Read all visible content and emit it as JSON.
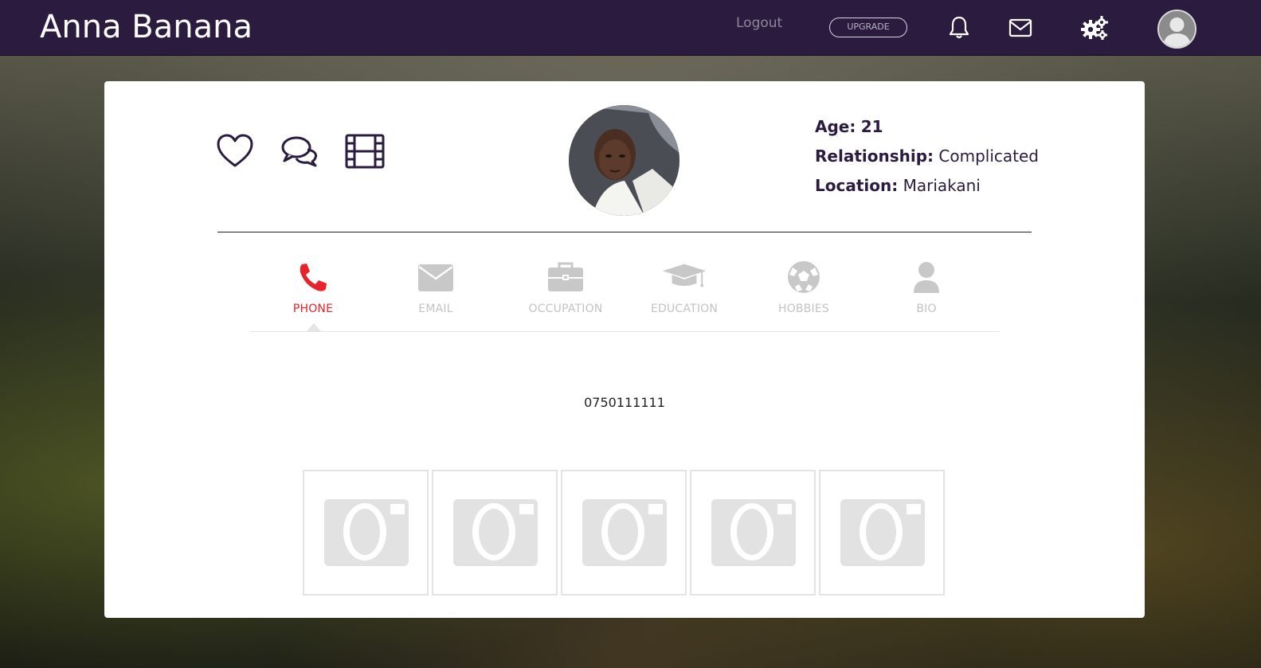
{
  "header": {
    "brand": "Anna Banana",
    "logout_label": "Logout",
    "upgrade_label": "UPGRADE",
    "icons": [
      "bell-icon",
      "envelope-icon",
      "gears-icon",
      "user-avatar"
    ]
  },
  "profile": {
    "actions": [
      "heart-icon",
      "chat-bubbles-icon",
      "film-icon"
    ],
    "age_label": "Age:",
    "age_value": "21",
    "relationship_label": "Relationship:",
    "relationship_value": "Complicated",
    "location_label": "Location:",
    "location_value": "Mariakani"
  },
  "tabs": [
    {
      "label": "PHONE",
      "icon": "phone-icon",
      "active": true
    },
    {
      "label": "EMAIL",
      "icon": "envelope-icon",
      "active": false
    },
    {
      "label": "OCCUPATION",
      "icon": "briefcase-icon",
      "active": false
    },
    {
      "label": "EDUCATION",
      "icon": "graduation-cap-icon",
      "active": false
    },
    {
      "label": "HOBBIES",
      "icon": "soccer-ball-icon",
      "active": false
    },
    {
      "label": "BIO",
      "icon": "user-icon",
      "active": false
    }
  ],
  "tab_content": {
    "phone_value": "0750111111"
  },
  "gallery": {
    "slot_icon": "camera-icon",
    "slots": 5
  },
  "colors": {
    "header_bg": "#2a1b3f",
    "accent_active": "#e8232a",
    "inactive_tab": "#c3c3c3",
    "icon_dark": "#2a1b3f"
  }
}
